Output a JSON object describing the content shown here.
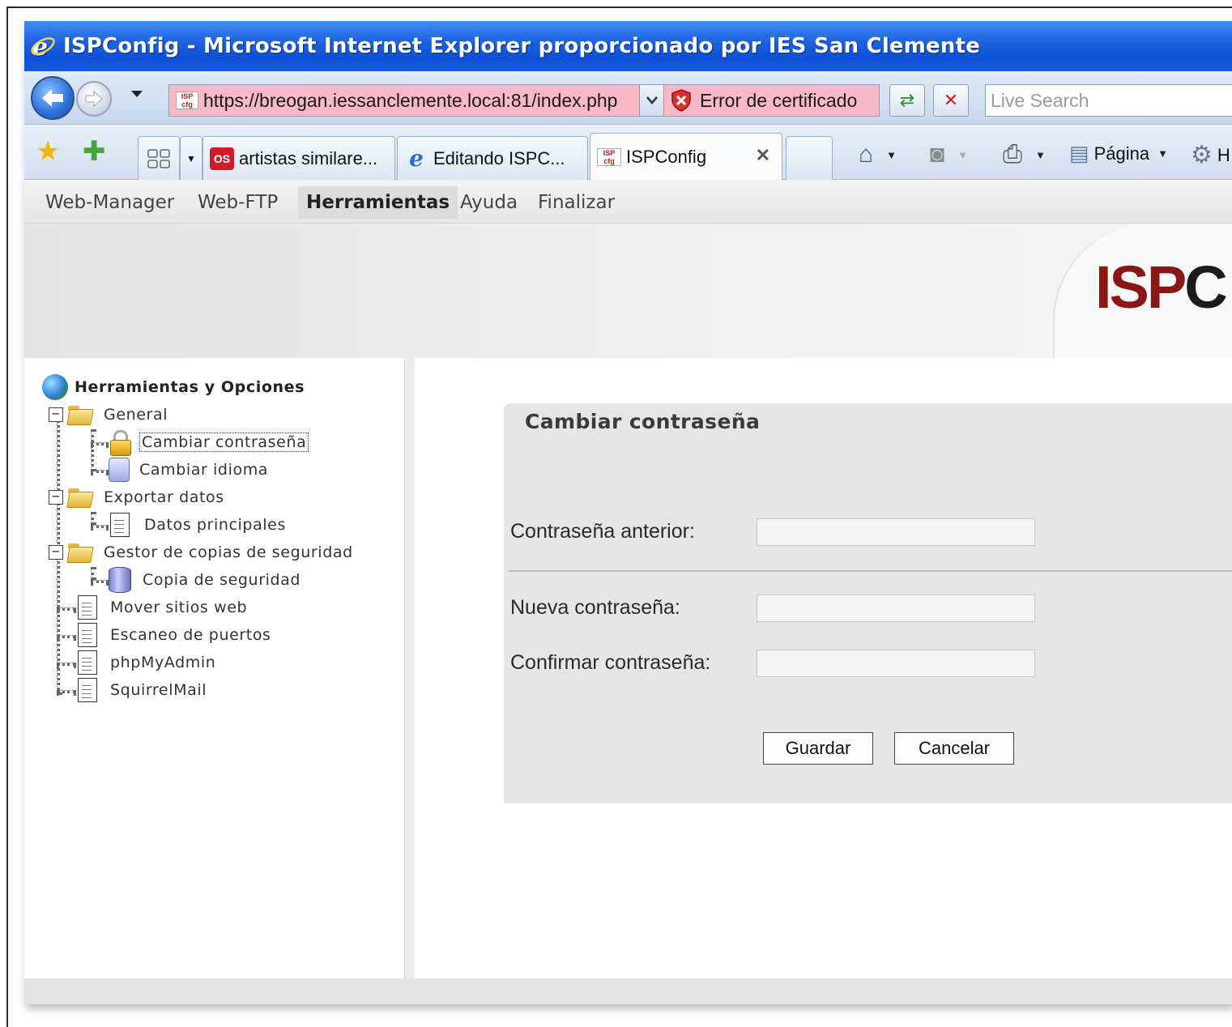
{
  "window": {
    "title": "ISPConfig - Microsoft Internet Explorer proporcionado por IES San Clemente"
  },
  "address_bar": {
    "url": "https://breogan.iessanclemente.local:81/index.php",
    "certificate_error": "Error de certificado",
    "search_placeholder": "Live Search"
  },
  "tabs": [
    {
      "label": "artistas similare...",
      "icon": "lastfm-icon"
    },
    {
      "label": "Editando ISPC...",
      "icon": "ie-icon"
    },
    {
      "label": "ISPConfig",
      "icon": "ispconfig-favicon",
      "active": true
    }
  ],
  "command_bar": {
    "page_label": "Página",
    "tools_label": "H"
  },
  "top_menu": {
    "items": [
      "Web-Manager",
      "Web-FTP",
      "Herramientas",
      "Ayuda",
      "Finalizar"
    ],
    "active": "Herramientas"
  },
  "logo": {
    "part1": "ISP",
    "part2": "C"
  },
  "tree": {
    "root": "Herramientas y Opciones",
    "general": "General",
    "change_password": "Cambiar contraseña",
    "change_language": "Cambiar idioma",
    "export_data": "Exportar datos",
    "main_data": "Datos principales",
    "backup_manager": "Gestor de copias de seguridad",
    "backup": "Copia de seguridad",
    "move_sites": "Mover sitios web",
    "port_scan": "Escaneo de puertos",
    "phpmyadmin": "phpMyAdmin",
    "squirrelmail": "SquirrelMail"
  },
  "form": {
    "title": "Cambiar contraseña",
    "old_password_label": "Contraseña anterior:",
    "old_password_value": "",
    "new_password_label": "Nueva contraseña:",
    "new_password_value": "",
    "confirm_password_label": "Confirmar contraseña:",
    "confirm_password_value": "",
    "save_label": "Guardar",
    "cancel_label": "Cancelar"
  }
}
